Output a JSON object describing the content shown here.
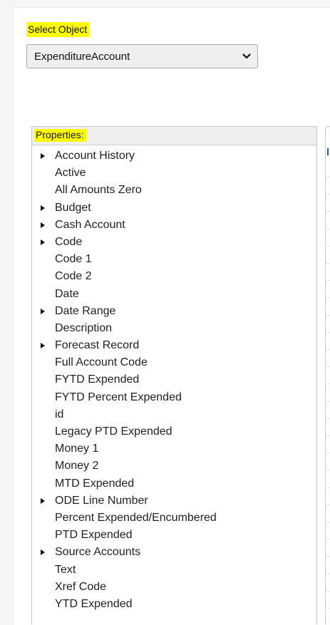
{
  "select_object": {
    "label": "Select Object",
    "selected_value": "ExpenditureAccount"
  },
  "properties": {
    "title": "Properties:",
    "items": [
      {
        "label": "Account History",
        "expandable": true
      },
      {
        "label": "Active",
        "expandable": false
      },
      {
        "label": "All Amounts Zero",
        "expandable": false
      },
      {
        "label": "Budget",
        "expandable": true
      },
      {
        "label": "Cash Account",
        "expandable": true
      },
      {
        "label": "Code",
        "expandable": true
      },
      {
        "label": "Code 1",
        "expandable": false
      },
      {
        "label": "Code 2",
        "expandable": false
      },
      {
        "label": "Date",
        "expandable": false
      },
      {
        "label": "Date Range",
        "expandable": true
      },
      {
        "label": "Description",
        "expandable": false
      },
      {
        "label": "Forecast Record",
        "expandable": true
      },
      {
        "label": "Full Account Code",
        "expandable": false
      },
      {
        "label": "FYTD Expended",
        "expandable": false
      },
      {
        "label": "FYTD Percent Expended",
        "expandable": false
      },
      {
        "label": "id",
        "expandable": false
      },
      {
        "label": "Legacy PTD Expended",
        "expandable": false
      },
      {
        "label": "Money 1",
        "expandable": false
      },
      {
        "label": "Money 2",
        "expandable": false
      },
      {
        "label": "MTD Expended",
        "expandable": false
      },
      {
        "label": "ODE Line Number",
        "expandable": true
      },
      {
        "label": "Percent Expended/Encumbered",
        "expandable": false
      },
      {
        "label": "PTD Expended",
        "expandable": false
      },
      {
        "label": "Source Accounts",
        "expandable": true
      },
      {
        "label": "Text",
        "expandable": false
      },
      {
        "label": "Xref Code",
        "expandable": false
      },
      {
        "label": "YTD Expended",
        "expandable": false
      }
    ]
  },
  "colors": {
    "highlight": "#ffff00",
    "panel_border": "#c8c8c8",
    "header_background": "#efefef",
    "accent": "#1f5f99"
  },
  "icons": {
    "select_chevron": "chevron-down-icon",
    "expand_arrow": "triangle-right-icon"
  }
}
